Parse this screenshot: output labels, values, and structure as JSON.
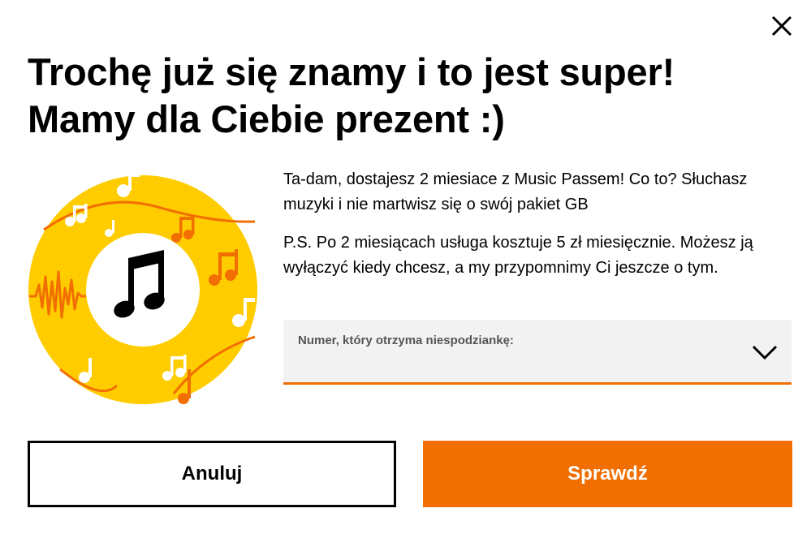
{
  "dialog": {
    "title_line1": "Trochę już się znamy i to jest super!",
    "title_line2": "Mamy dla Ciebie prezent :)",
    "description": [
      "Ta-dam, dostajesz 2 miesiace z Music Passem! Co to? Słuchasz muzyki i nie martwisz się o swój pakiet GB",
      "P.S. Po 2 miesiącach usługa kosztuje 5 zł miesięcznie. Możesz ją wyłączyć kiedy chcesz, a my przypomnimy Ci jeszcze o tym."
    ],
    "number_select": {
      "label": "Numer, który otrzyma niespodziankę:",
      "value": ""
    },
    "buttons": {
      "cancel": "Anuluj",
      "check": "Sprawdź"
    }
  },
  "icons": {
    "close": "close-icon",
    "illustration": "music-note-icon",
    "dropdown": "chevron-down-icon"
  },
  "colors": {
    "accent": "#f16e00",
    "ring": "#ffcc00",
    "field_bg": "#f2f2f2",
    "text": "#000000"
  }
}
